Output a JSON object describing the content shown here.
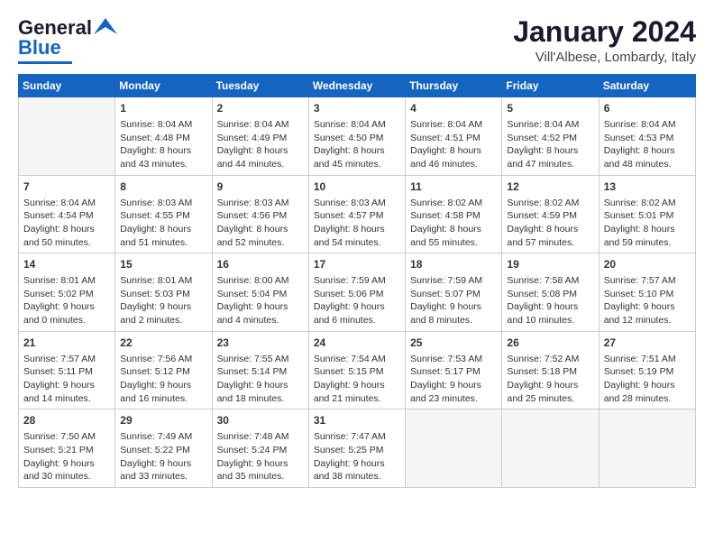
{
  "logo": {
    "line1": "General",
    "line2": "Blue"
  },
  "title": "January 2024",
  "subtitle": "Vill'Albese, Lombardy, Italy",
  "days_of_week": [
    "Sunday",
    "Monday",
    "Tuesday",
    "Wednesday",
    "Thursday",
    "Friday",
    "Saturday"
  ],
  "weeks": [
    [
      {
        "day": "",
        "info": ""
      },
      {
        "day": "1",
        "info": "Sunrise: 8:04 AM\nSunset: 4:48 PM\nDaylight: 8 hours\nand 43 minutes."
      },
      {
        "day": "2",
        "info": "Sunrise: 8:04 AM\nSunset: 4:49 PM\nDaylight: 8 hours\nand 44 minutes."
      },
      {
        "day": "3",
        "info": "Sunrise: 8:04 AM\nSunset: 4:50 PM\nDaylight: 8 hours\nand 45 minutes."
      },
      {
        "day": "4",
        "info": "Sunrise: 8:04 AM\nSunset: 4:51 PM\nDaylight: 8 hours\nand 46 minutes."
      },
      {
        "day": "5",
        "info": "Sunrise: 8:04 AM\nSunset: 4:52 PM\nDaylight: 8 hours\nand 47 minutes."
      },
      {
        "day": "6",
        "info": "Sunrise: 8:04 AM\nSunset: 4:53 PM\nDaylight: 8 hours\nand 48 minutes."
      }
    ],
    [
      {
        "day": "7",
        "info": "Sunrise: 8:04 AM\nSunset: 4:54 PM\nDaylight: 8 hours\nand 50 minutes."
      },
      {
        "day": "8",
        "info": "Sunrise: 8:03 AM\nSunset: 4:55 PM\nDaylight: 8 hours\nand 51 minutes."
      },
      {
        "day": "9",
        "info": "Sunrise: 8:03 AM\nSunset: 4:56 PM\nDaylight: 8 hours\nand 52 minutes."
      },
      {
        "day": "10",
        "info": "Sunrise: 8:03 AM\nSunset: 4:57 PM\nDaylight: 8 hours\nand 54 minutes."
      },
      {
        "day": "11",
        "info": "Sunrise: 8:02 AM\nSunset: 4:58 PM\nDaylight: 8 hours\nand 55 minutes."
      },
      {
        "day": "12",
        "info": "Sunrise: 8:02 AM\nSunset: 4:59 PM\nDaylight: 8 hours\nand 57 minutes."
      },
      {
        "day": "13",
        "info": "Sunrise: 8:02 AM\nSunset: 5:01 PM\nDaylight: 8 hours\nand 59 minutes."
      }
    ],
    [
      {
        "day": "14",
        "info": "Sunrise: 8:01 AM\nSunset: 5:02 PM\nDaylight: 9 hours\nand 0 minutes."
      },
      {
        "day": "15",
        "info": "Sunrise: 8:01 AM\nSunset: 5:03 PM\nDaylight: 9 hours\nand 2 minutes."
      },
      {
        "day": "16",
        "info": "Sunrise: 8:00 AM\nSunset: 5:04 PM\nDaylight: 9 hours\nand 4 minutes."
      },
      {
        "day": "17",
        "info": "Sunrise: 7:59 AM\nSunset: 5:06 PM\nDaylight: 9 hours\nand 6 minutes."
      },
      {
        "day": "18",
        "info": "Sunrise: 7:59 AM\nSunset: 5:07 PM\nDaylight: 9 hours\nand 8 minutes."
      },
      {
        "day": "19",
        "info": "Sunrise: 7:58 AM\nSunset: 5:08 PM\nDaylight: 9 hours\nand 10 minutes."
      },
      {
        "day": "20",
        "info": "Sunrise: 7:57 AM\nSunset: 5:10 PM\nDaylight: 9 hours\nand 12 minutes."
      }
    ],
    [
      {
        "day": "21",
        "info": "Sunrise: 7:57 AM\nSunset: 5:11 PM\nDaylight: 9 hours\nand 14 minutes."
      },
      {
        "day": "22",
        "info": "Sunrise: 7:56 AM\nSunset: 5:12 PM\nDaylight: 9 hours\nand 16 minutes."
      },
      {
        "day": "23",
        "info": "Sunrise: 7:55 AM\nSunset: 5:14 PM\nDaylight: 9 hours\nand 18 minutes."
      },
      {
        "day": "24",
        "info": "Sunrise: 7:54 AM\nSunset: 5:15 PM\nDaylight: 9 hours\nand 21 minutes."
      },
      {
        "day": "25",
        "info": "Sunrise: 7:53 AM\nSunset: 5:17 PM\nDaylight: 9 hours\nand 23 minutes."
      },
      {
        "day": "26",
        "info": "Sunrise: 7:52 AM\nSunset: 5:18 PM\nDaylight: 9 hours\nand 25 minutes."
      },
      {
        "day": "27",
        "info": "Sunrise: 7:51 AM\nSunset: 5:19 PM\nDaylight: 9 hours\nand 28 minutes."
      }
    ],
    [
      {
        "day": "28",
        "info": "Sunrise: 7:50 AM\nSunset: 5:21 PM\nDaylight: 9 hours\nand 30 minutes."
      },
      {
        "day": "29",
        "info": "Sunrise: 7:49 AM\nSunset: 5:22 PM\nDaylight: 9 hours\nand 33 minutes."
      },
      {
        "day": "30",
        "info": "Sunrise: 7:48 AM\nSunset: 5:24 PM\nDaylight: 9 hours\nand 35 minutes."
      },
      {
        "day": "31",
        "info": "Sunrise: 7:47 AM\nSunset: 5:25 PM\nDaylight: 9 hours\nand 38 minutes."
      },
      {
        "day": "",
        "info": ""
      },
      {
        "day": "",
        "info": ""
      },
      {
        "day": "",
        "info": ""
      }
    ]
  ]
}
